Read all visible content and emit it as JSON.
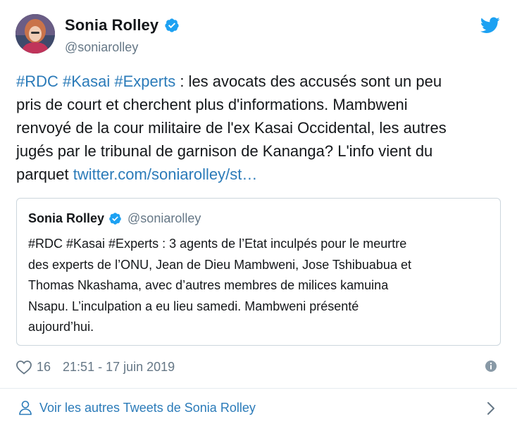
{
  "author": {
    "display_name": "Sonia Rolley",
    "handle": "@soniarolley",
    "verified": true
  },
  "tweet": {
    "hashtags": "#RDC #Kasai #Experts",
    "body": " : les avocats des accusés sont un peu\npris de court et cherchent plus d'informations. Mambweni\nrenvoyé de la cour militaire de l'ex Kasai Occidental, les autres\njugés par le tribunal de garnison de Kananga? L'info vient du\nparquet ",
    "link": "twitter.com/soniarolley/st…"
  },
  "quoted_tweet": {
    "display_name": "Sonia Rolley",
    "handle": "@soniarolley",
    "text": "#RDC #Kasai #Experts : 3 agents de l’Etat inculpés pour le meurtre\ndes experts de l’ONU, Jean de Dieu Mambweni, Jose Tshibuabua et\nThomas Nkashama, avec d’autres membres de milices kamuina\nNsapu. L’inculpation a eu lieu samedi. Mambweni présenté\naujourd’hui."
  },
  "meta": {
    "likes": "16",
    "timestamp": "21:51 - 17 juin 2019"
  },
  "footer": {
    "more_tweets_label": "Voir les autres Tweets de Sonia Rolley"
  },
  "icons": {
    "verified": "verified-badge-icon",
    "twitter": "twitter-bird-icon",
    "like": "heart-icon",
    "info": "info-icon",
    "person": "person-icon",
    "chevron": "chevron-right-icon"
  },
  "colors": {
    "link": "#2b7bb9",
    "verified": "#1da1f2",
    "secondary_text": "#657786",
    "border": "#ccd6dd"
  }
}
